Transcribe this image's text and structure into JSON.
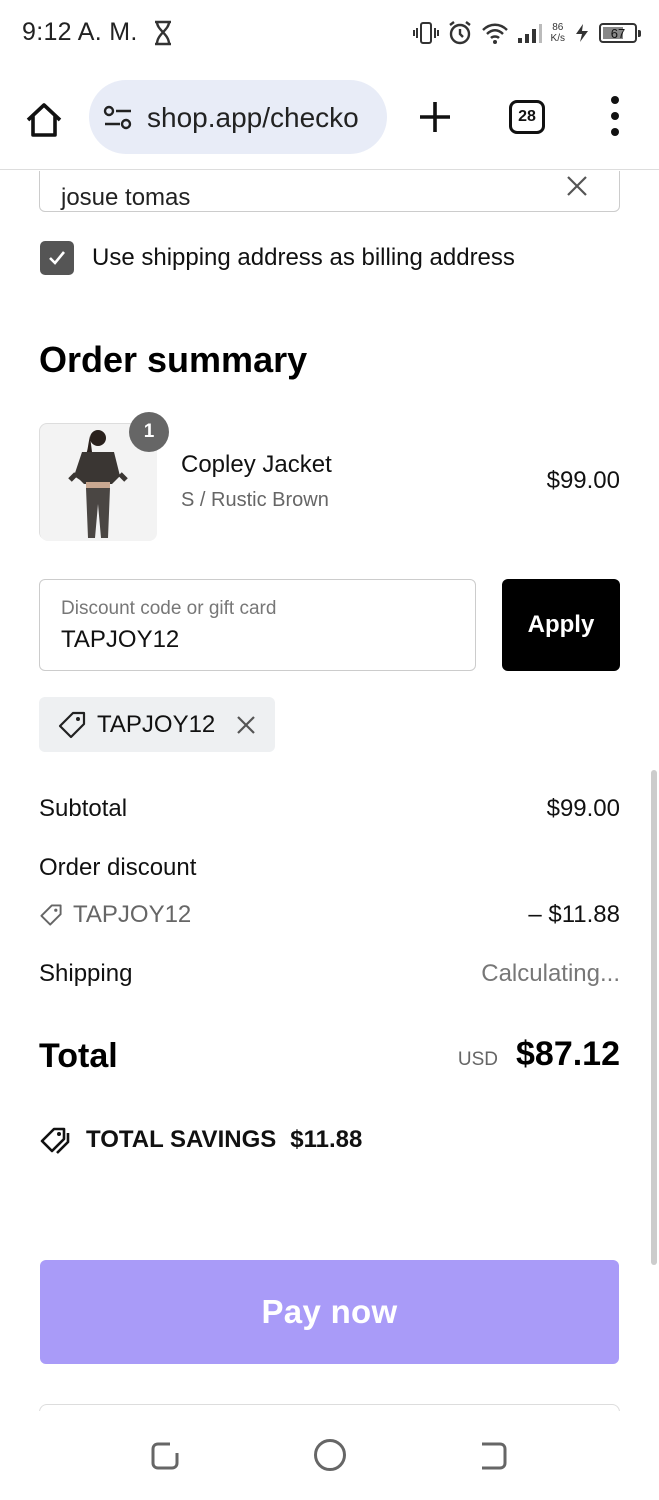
{
  "status_bar": {
    "time": "9:12 A. M.",
    "net_speed_value": "86",
    "net_speed_unit": "K/s",
    "battery_percent": "67",
    "battery_level": 0.67
  },
  "browser": {
    "url": "shop.app/checko",
    "tab_count": "28"
  },
  "checkout": {
    "name_value": "josue tomas",
    "billing_checkbox_label": "Use shipping address as billing address",
    "billing_checked": true,
    "summary_title": "Order summary",
    "product": {
      "quantity": "1",
      "name": "Copley Jacket",
      "variant": "S / Rustic Brown",
      "price": "$99.00"
    },
    "discount": {
      "placeholder": "Discount code or gift card",
      "value": "TAPJOY12",
      "apply_label": "Apply",
      "applied_code": "TAPJOY12"
    },
    "lines": {
      "subtotal_label": "Subtotal",
      "subtotal_value": "$99.00",
      "order_discount_label": "Order discount",
      "discount_code": "TAPJOY12",
      "discount_value": "– $11.88",
      "shipping_label": "Shipping",
      "shipping_value": "Calculating..."
    },
    "total": {
      "label": "Total",
      "currency": "USD",
      "amount": "$87.12"
    },
    "savings": {
      "label": "TOTAL SAVINGS",
      "amount": "$11.88"
    },
    "pay_label": "Pay now"
  },
  "colors": {
    "pay_button": "#a99bf8",
    "apply_button": "#000000",
    "url_pill": "#e8ecf7"
  }
}
